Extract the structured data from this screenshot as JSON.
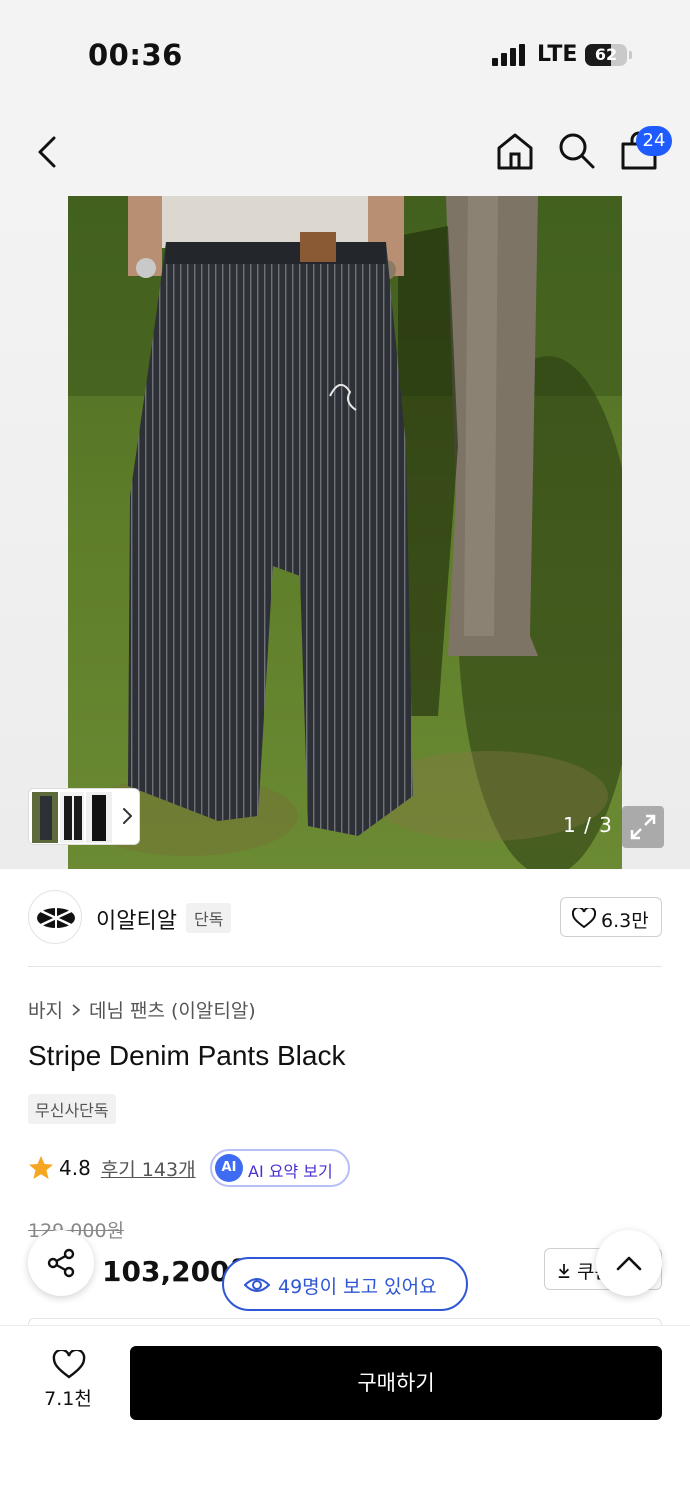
{
  "status_bar": {
    "time": "00:36",
    "network": "LTE",
    "battery": "62",
    "battery_level": 0.62
  },
  "header": {
    "cart_count": "24"
  },
  "gallery": {
    "page_counter": "1 / 3"
  },
  "brand": {
    "name": "이알티알",
    "tag": "단독",
    "likes": "6.3만"
  },
  "product": {
    "breadcrumb": [
      "바지",
      "데님 팬츠 (이알티알)"
    ],
    "title": "Stripe Denim Pants Black",
    "tag": "무신사단독",
    "rating": "4.8",
    "reviews": "후기 143개",
    "ai_badge": "AI",
    "ai_summary": "AI 요약 보기",
    "original_price": "129,000원",
    "sale_price": "103,200원",
    "coupon_label": "쿠폰"
  },
  "viewers": "49명이 보고 있어요",
  "bottom_bar": {
    "wishlist_count": "7.1천",
    "buy_label": "구매하기"
  },
  "colors": {
    "accent_blue": "#1f5cff",
    "star": "#f5a623",
    "buy_button": "#000000"
  },
  "icons": [
    "back-icon",
    "home-icon",
    "search-icon",
    "shopping-bag-icon",
    "chevron-right-icon",
    "expand-icon",
    "heart-icon",
    "star-icon",
    "share-icon",
    "download-icon",
    "chevron-up-icon",
    "eye-icon"
  ]
}
